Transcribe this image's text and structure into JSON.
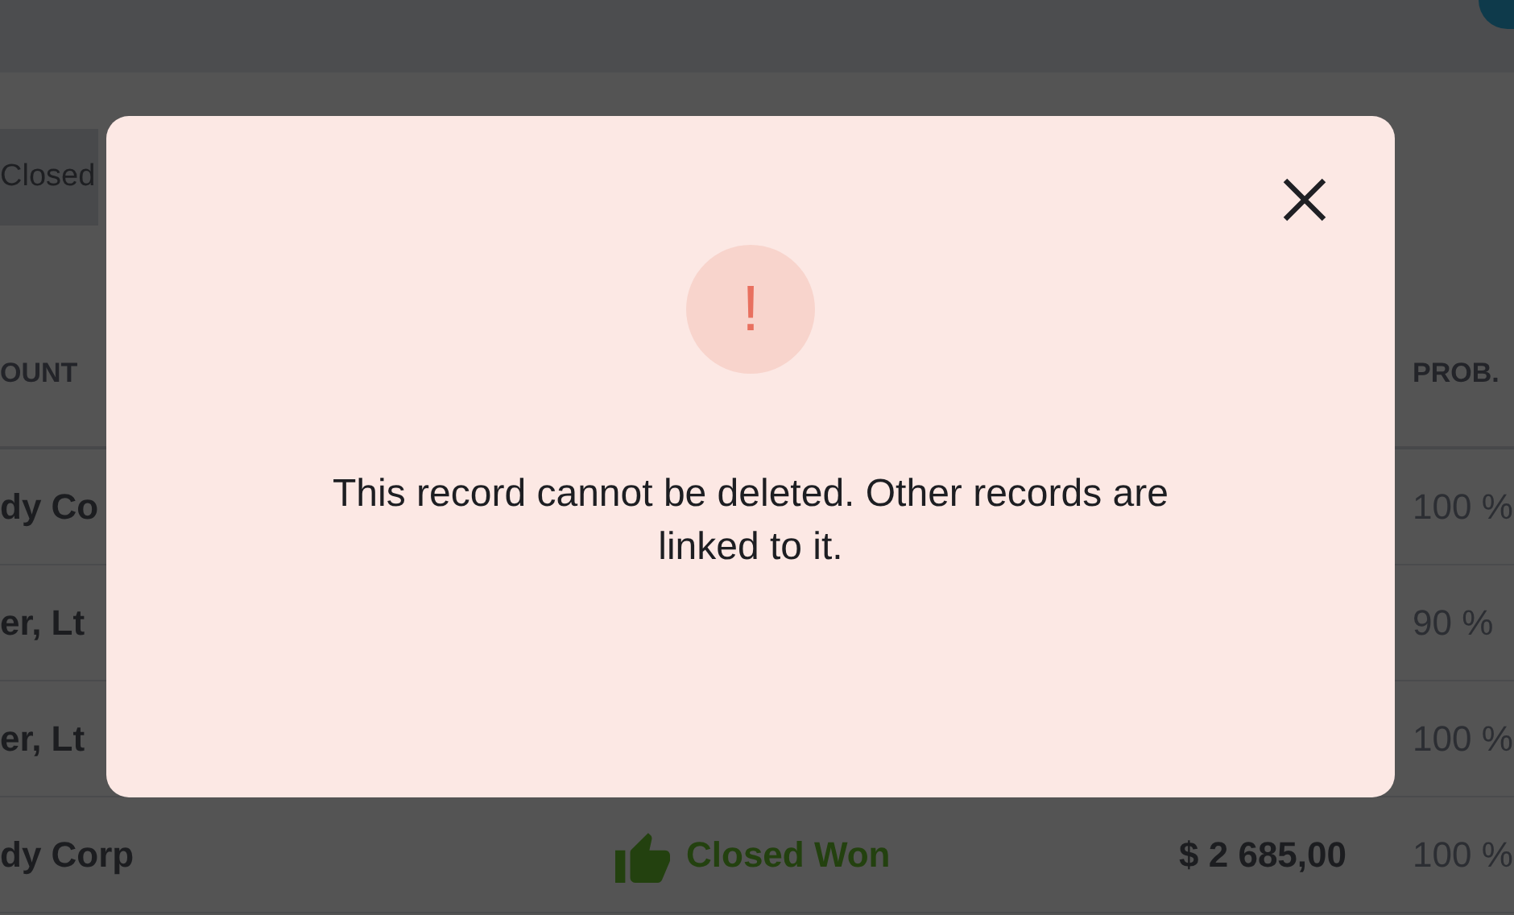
{
  "filter_chip": {
    "label": "Closed"
  },
  "table": {
    "columns": [
      {
        "label": "OUNT"
      },
      {
        "label": "PROB."
      }
    ],
    "rows": [
      {
        "account": "dy Co",
        "probability": "100 %"
      },
      {
        "account": "er, Lt",
        "probability": "90 %"
      },
      {
        "account": "er, Lt",
        "probability": "100 %"
      },
      {
        "account": "dy Corp",
        "stage": {
          "kind": "won",
          "label": "Closed Won"
        },
        "amount": "$ 2 685,00",
        "probability": "100 %"
      }
    ]
  },
  "dialog": {
    "kind": "error",
    "icon_glyph": "!",
    "message": "This record cannot be deleted. Other records are linked to it."
  }
}
